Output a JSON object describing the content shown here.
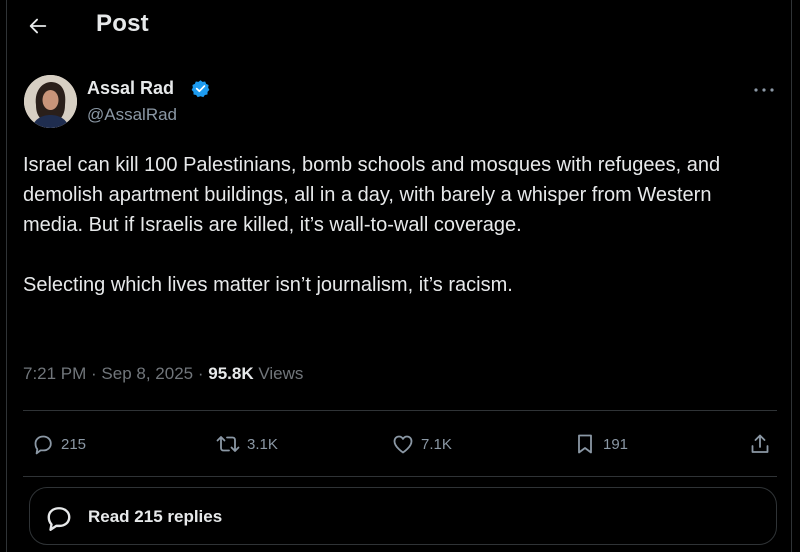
{
  "header": {
    "title": "Post",
    "back_icon": "arrow-left-icon"
  },
  "author": {
    "name": "Assal Rad",
    "handle": "@AssalRad",
    "verified": true,
    "verified_color": "#1d9bf0"
  },
  "post": {
    "paragraphs": [
      "Israel can kill 100 Palestinians, bomb schools and mosques with refugees, and demolish apartment buildings, all in a day, with barely a whisper from Western media. But if Israelis are killed, it’s wall-to-wall coverage.",
      "Selecting which lives matter isn’t journalism, it’s racism."
    ],
    "time": "7:21 PM",
    "date": "Sep 8, 2025",
    "views_count": "95.8K",
    "views_label": "Views"
  },
  "actions": {
    "replies": "215",
    "reposts": "3.1K",
    "likes": "7.1K",
    "bookmarks": "191"
  },
  "read_replies": {
    "label": "Read 215 replies"
  },
  "colors": {
    "background": "#000000",
    "text": "#e7e9ea",
    "muted": "#71767b",
    "border": "#2f3336"
  }
}
